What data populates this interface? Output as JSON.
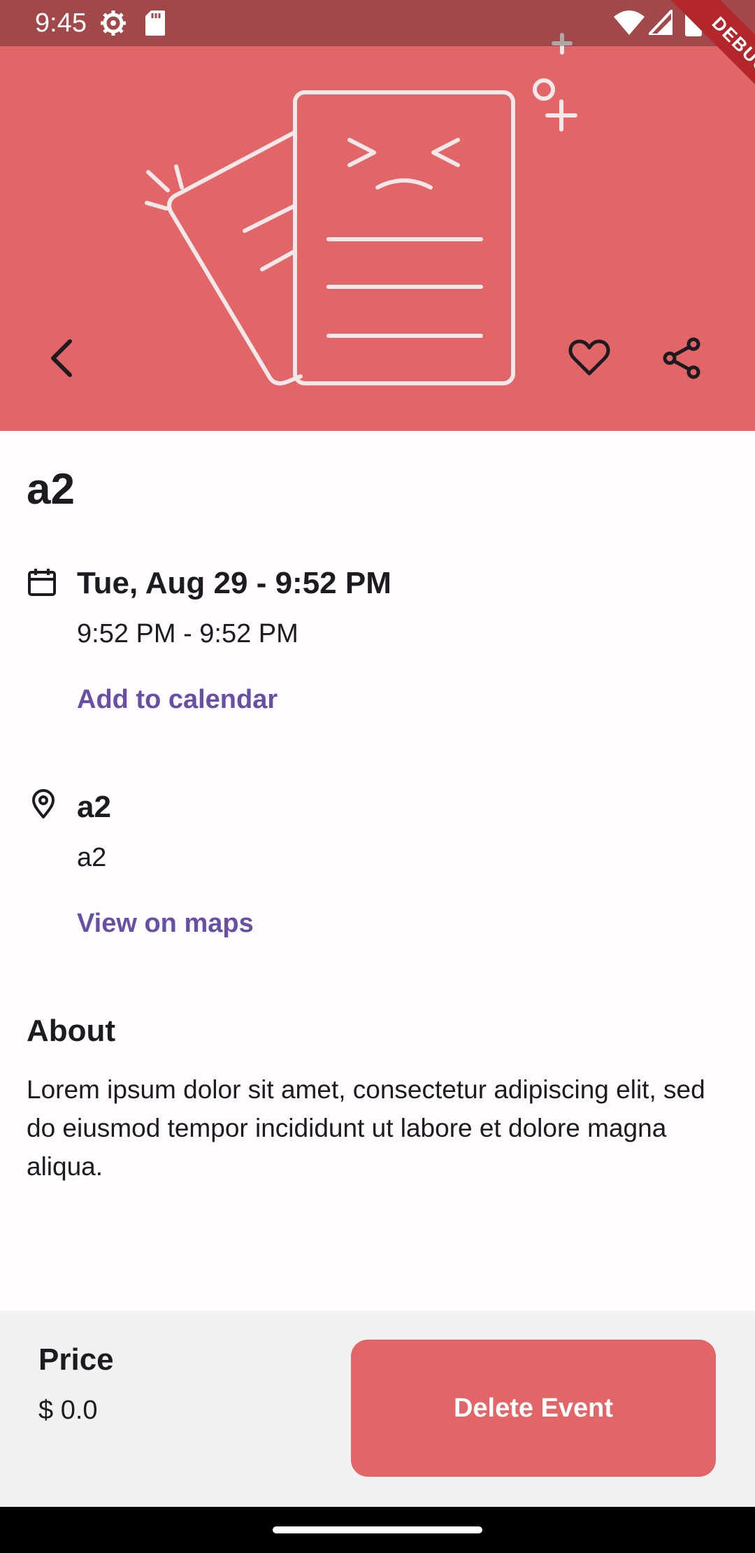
{
  "status_bar": {
    "time": "9:45"
  },
  "debug_banner": "DEBUG",
  "event": {
    "title": "a2",
    "date_main": "Tue, Aug 29 - 9:52 PM",
    "time_range": "9:52 PM - 9:52 PM",
    "add_to_calendar": "Add to calendar",
    "location_name": "a2",
    "location_address": "a2",
    "view_on_maps": "View on maps",
    "about_title": "About",
    "about_text": "Lorem ipsum dolor sit amet, consectetur adipiscing elit, sed do eiusmod tempor incididunt ut labore et dolore magna aliqua."
  },
  "bottom_bar": {
    "price_label": "Price",
    "price_value": "$ 0.0",
    "delete_label": "Delete Event"
  },
  "icons": {
    "back": "chevron-left-icon",
    "favorite": "heart-outline-icon",
    "share": "share-icon",
    "calendar": "calendar-icon",
    "location": "map-pin-icon"
  },
  "colors": {
    "hero_background": "#e26567",
    "accent": "#6750a4",
    "delete_button": "#e26567",
    "page_background": "#fffbfe",
    "bottom_bar_background": "#f2f1f2"
  }
}
